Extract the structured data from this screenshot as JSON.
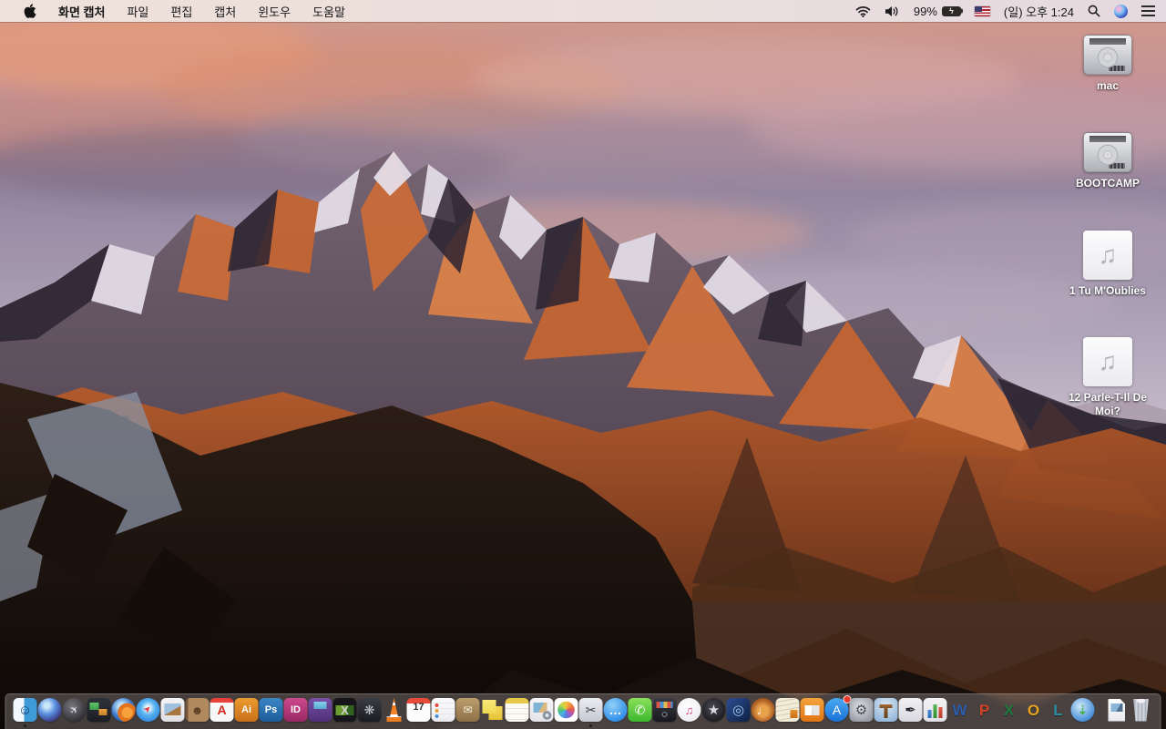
{
  "menu_bar": {
    "apple_icon": "apple-logo",
    "menus": [
      {
        "key": "app",
        "label": "화면 캡처",
        "active": true
      },
      {
        "key": "file",
        "label": "파일",
        "active": false
      },
      {
        "key": "edit",
        "label": "편집",
        "active": false
      },
      {
        "key": "capture",
        "label": "캡처",
        "active": false
      },
      {
        "key": "window",
        "label": "윈도우",
        "active": false
      },
      {
        "key": "help",
        "label": "도움말",
        "active": false
      }
    ],
    "status": {
      "battery_percent": "99%",
      "battery_charging": true,
      "clock": "(일) 오후 1:24",
      "icons": [
        "wifi-icon",
        "volume-icon",
        "battery-icon",
        "us-flag-icon",
        "spotlight-icon",
        "siri-icon",
        "notification-center-icon"
      ]
    }
  },
  "desktop": {
    "wallpaper": {
      "theme": "sierra-mountain-sunset",
      "sky_top": "#d49a87",
      "sky_mid": "#95869f",
      "sunlit_rock": "#cf6d36",
      "snow": "#e6e0ea",
      "foreground_rock": "#1a110c"
    },
    "icons": [
      {
        "name": "mac",
        "label": "mac",
        "type": "hard-drive"
      },
      {
        "name": "bootcamp",
        "label": "BOOTCAMP",
        "type": "hard-drive"
      },
      {
        "name": "tu-moublies",
        "label": "1 Tu M'Oublies",
        "type": "audio-file",
        "glyph": "♫"
      },
      {
        "name": "parle-t-il-de-moi",
        "label": "12 Parle-T-Il De Moi?",
        "type": "audio-file",
        "glyph": "♫"
      }
    ]
  },
  "dock": {
    "items": [
      {
        "name": "finder",
        "glyph": "☺",
        "fg": "#17406e",
        "fs": 15,
        "bg": "linear-gradient(90deg,#f0f8fd 0 46%,#3f9ad8 46%)",
        "shape": "square",
        "running": true
      },
      {
        "name": "siri",
        "glyph": "",
        "bg": "radial-gradient(circle at 38% 32%,#c8e8f8 0 12%,#5a8fe0 40%,#33246a 85%)",
        "shape": "circle"
      },
      {
        "name": "launchpad",
        "glyph": "✈",
        "fg": "#d8d8de",
        "fs": 12,
        "rot": -45,
        "bg": "radial-gradient(circle at 40% 35%,#77777d,#2e2e33 75%)",
        "shape": "circle"
      },
      {
        "name": "mission-control",
        "glyph": "",
        "bg": "linear-gradient(#5fc46a,#3f9f4a) 3px 5px/10px 8px no-repeat,linear-gradient(#e8a23c,#c8822a) 13px 12px/9px 7px no-repeat,linear-gradient(#2e3138,#1c1e24)",
        "shape": "square"
      },
      {
        "name": "firefox",
        "glyph": "",
        "bg": "radial-gradient(circle at 66% 62%,#f6a13b 0 26%,#e5741f 26% 44%,rgba(0,0,0,0) 45%),radial-gradient(circle at 42% 36%,#bfe0f6 0 16%,#3e7bd0 50%,#1c3f77)",
        "shape": "circle"
      },
      {
        "name": "safari",
        "glyph": "➤",
        "fg": "#e23b3b",
        "fs": 10,
        "rot": -45,
        "bg": "radial-gradient(circle at 50% 42%,#eef8ff 0 10%,#55b2f0 40%,#1f6fd0)",
        "shape": "circle"
      },
      {
        "name": "preview",
        "glyph": "",
        "bg": "linear-gradient(150deg,#9fc0dc 0 55%,#a8763f 55%) 4px 6px/18px 13px no-repeat,linear-gradient(#f4f4f6,#dfdfe4)",
        "shape": "square"
      },
      {
        "name": "contacts",
        "glyph": "☻",
        "fg": "#5a3f26",
        "fs": 13,
        "bg": "linear-gradient(90deg,#77573a 0 12%,#b08a5e 12%)",
        "shape": "square"
      },
      {
        "name": "acrobat",
        "glyph": "A",
        "fg": "#d2281e",
        "fs": 14,
        "bold": true,
        "bg": "linear-gradient(#e8413a 0 5px,#f7f7f7 5px)",
        "shape": "square"
      },
      {
        "name": "illustrator",
        "glyph": "Ai",
        "fg": "#ffffff",
        "fs": 11,
        "bold": true,
        "bg": "linear-gradient(#eb9a2f,#c9701a)",
        "shape": "square"
      },
      {
        "name": "photoshop",
        "glyph": "Ps",
        "fg": "#ffffff",
        "fs": 11,
        "bold": true,
        "bg": "linear-gradient(#3a85c4,#1d5c9a)",
        "shape": "square"
      },
      {
        "name": "indesign",
        "glyph": "ID",
        "fg": "#ffffff",
        "fs": 11,
        "bold": true,
        "bg": "linear-gradient(#cc4a8e,#992864)",
        "shape": "square"
      },
      {
        "name": "toast",
        "glyph": "",
        "bg": "linear-gradient(#86d2ec,#58a8d2) 6px 4px/14px 8px no-repeat,linear-gradient(#7a4fa8,#4e2f78)",
        "shape": "square"
      },
      {
        "name": "app-x",
        "glyph": "X",
        "fg": "#d0d0d6",
        "fs": 13,
        "bold": true,
        "bg": "linear-gradient(105deg,#6a9c2f 0 60%,#31641f 60%) 3px 8px/20px 11px no-repeat,#16161a",
        "shape": "square"
      },
      {
        "name": "fan-utility",
        "glyph": "❋",
        "fg": "#c2c2cc",
        "fs": 14,
        "bg": "linear-gradient(#3c3c44,#1b1b22)",
        "shape": "square"
      },
      {
        "name": "vlc",
        "glyph": "",
        "bg": "repeating-linear-gradient(180deg,#f08528 0 5px,#ffffff 5px 8px,#ef7c1e 8px 13px)",
        "shape": "cone"
      },
      {
        "name": "calendar",
        "glyph": "17",
        "fg": "#333333",
        "fs": 11,
        "bold": true,
        "pad_top": 5,
        "bg": "linear-gradient(#e84b3a 0 6px,#fcfcfc 6px)",
        "shape": "square"
      },
      {
        "name": "reminders",
        "glyph": "",
        "bg": "radial-gradient(circle 2px at 6px 8px,#e5493a 97%,rgba(0,0,0,0)),radial-gradient(circle 2px at 6px 14px,#e8a13c 97%,rgba(0,0,0,0)),radial-gradient(circle 2px at 6px 20px,#4a90d9 97%,rgba(0,0,0,0)),repeating-linear-gradient(rgba(0,0,0,0) 0 5px,#e4e4ea 5px 6px),linear-gradient(#fbfbfd,#eeeef2)",
        "shape": "square"
      },
      {
        "name": "archive-utility",
        "glyph": "✉",
        "fg": "#f4eedd",
        "fs": 12,
        "bg": "linear-gradient(#bb9d6d,#8e7048)",
        "shape": "square"
      },
      {
        "name": "stickies",
        "glyph": "",
        "bg": "linear-gradient(#f8e87a,#f0d84f) 2px 2px/15px 15px no-repeat,linear-gradient(#f2d855,#e4c23a) 9px 9px/15px 15px no-repeat",
        "shape": "plain"
      },
      {
        "name": "notes",
        "glyph": "",
        "bg": "linear-gradient(#e8c84a 0 6px,rgba(0,0,0,0) 6px),repeating-linear-gradient(#fcfcf5 0 5px,#e2e2d8 5px 6px)",
        "shape": "square"
      },
      {
        "name": "image-capture",
        "glyph": "",
        "bg": "radial-gradient(circle 5px at 19px 19px,#e2e6ec 0 2px,#8a93a2 2px 4.5px,rgba(0,0,0,0) 5px),linear-gradient(120deg,#7fb3d8 0 55%,#d8b87f 55%) 4px 5px/15px 11px no-repeat,linear-gradient(#f6f6f8,#e4e4ea)",
        "shape": "square"
      },
      {
        "name": "photos",
        "glyph": "",
        "bg": "radial-gradient(circle at 50% 50%,rgba(0,0,0,0) 0 9px,#ffffff 9.5px),conic-gradient(#f3c13f,#ee8b3b,#e05656,#a85cc9,#5b79dd,#45b4e5,#52c06f,#c2d84d,#f3c13f)",
        "shape": "square"
      },
      {
        "name": "grab-screen-capture",
        "glyph": "✂",
        "fg": "#3a3a42",
        "fs": 14,
        "bg": "linear-gradient(#ecedf1,#c6c8d2)",
        "shape": "square",
        "running": true
      },
      {
        "name": "messages",
        "glyph": "…",
        "fg": "#ffffff",
        "fs": 14,
        "bold": true,
        "bg": "radial-gradient(circle at 38% 30%,#8fd0f8,#2e8de8 75%)",
        "shape": "circle"
      },
      {
        "name": "facetime",
        "glyph": "✆",
        "fg": "#ffffff",
        "fs": 14,
        "bg": "linear-gradient(#8ae05a,#3cb82e)",
        "shape": "square"
      },
      {
        "name": "photo-booth",
        "glyph": "",
        "bg": "repeating-linear-gradient(90deg,#d65547 0 4px,#4a90d9 4px 8px,#e2bc48 8px 12px) 4px 4px/18px 7px no-repeat,radial-gradient(circle 4px at 13px 18px,#15151a 0 1.5px,#6a6a74 1.5px 3px,#2a2a32 3px 4px,rgba(0,0,0,0) 4.5px),linear-gradient(#3c3c46,#17171d)",
        "shape": "square"
      },
      {
        "name": "itunes",
        "glyph": "♫",
        "fg": "#d6487e",
        "fs": 13,
        "bg": "radial-gradient(circle at 42% 36%,#ffffff,#ececf2 80%)",
        "shape": "circle"
      },
      {
        "name": "imovie",
        "glyph": "★",
        "fg": "#d8d8de",
        "fs": 15,
        "bg": "radial-gradient(circle at 45% 40%,#4a4a52,#17171c 80%)",
        "shape": "circle"
      },
      {
        "name": "idvd",
        "glyph": "◎",
        "fg": "#9ec8f2",
        "fs": 15,
        "bg": "linear-gradient(135deg,#2c4f92,#101f42)",
        "shape": "square"
      },
      {
        "name": "garageband",
        "glyph": "♩",
        "fg": "#ffffff",
        "fs": 13,
        "bg": "radial-gradient(circle at 50% 55%,#e8a24c 0 30%,#b26428 60%,#6e3a14)",
        "shape": "circle"
      },
      {
        "name": "documents-app",
        "glyph": "",
        "bg": "linear-gradient(#e8912d,#c96f16) 16px 13px/8px 9px no-repeat,repeating-linear-gradient(170deg,#f2ecd9 0 4px,#d4cbb2 4px 5px)",
        "shape": "square"
      },
      {
        "name": "ibooks",
        "glyph": "",
        "bg": "linear-gradient(#d0d0d0,#d0d0d0) 12.5px 8px/1px 11px no-repeat,linear-gradient(100deg,#ffffff 0 48%,#e6e6e6 52%) 5px 8px/16px 11px no-repeat,linear-gradient(#f4a43c,#e07414)",
        "shape": "square"
      },
      {
        "name": "app-store",
        "glyph": "A",
        "fg": "#ffffff",
        "fs": 14,
        "bg": "linear-gradient(#4aa8f0,#1a72d8)",
        "shape": "circle",
        "badge": true
      },
      {
        "name": "system-preferences",
        "glyph": "⚙",
        "fg": "#4a4a52",
        "fs": 15,
        "bg": "radial-gradient(circle at 45% 40%,#e2e2e8,#9598a2 80%)",
        "shape": "square"
      },
      {
        "name": "keynote",
        "glyph": "",
        "bg": "linear-gradient(#8a5a2a,#66401a) 11px 10px/4px 12px no-repeat,linear-gradient(#a8713a,#7c4c22) 6px 7px/14px 4px no-repeat,radial-gradient(circle at 50% 30%,#d8e6f2,#86aed6)",
        "shape": "square"
      },
      {
        "name": "pages",
        "glyph": "✒",
        "fg": "#26262e",
        "fs": 15,
        "bg": "linear-gradient(#f2f2f5,#d8d8de)",
        "shape": "square"
      },
      {
        "name": "numbers",
        "glyph": "",
        "bg": "linear-gradient(#4a90d9,#2a6ab0) 5px 13px/4px 9px no-repeat,linear-gradient(#58b858,#2f8f2f) 11px 7px/4px 15px no-repeat,linear-gradient(#e05a4a,#b83a2a) 17px 10px/4px 12px no-repeat,linear-gradient(#f4f4f6,#e0e0e6)",
        "shape": "square"
      },
      {
        "name": "word",
        "glyph": "W",
        "fg": "#2b5cad",
        "fs": 17,
        "bold": true,
        "bg": "rgba(0,0,0,0)",
        "shape": "plain"
      },
      {
        "name": "powerpoint",
        "glyph": "P",
        "fg": "#d14224",
        "fs": 17,
        "bold": true,
        "bg": "rgba(0,0,0,0)",
        "shape": "plain"
      },
      {
        "name": "excel",
        "glyph": "X",
        "fg": "#1e7a3c",
        "fs": 17,
        "bold": true,
        "bg": "rgba(0,0,0,0)",
        "shape": "plain"
      },
      {
        "name": "outlook",
        "glyph": "O",
        "fg": "#e8a41e",
        "fs": 17,
        "bold": true,
        "bg": "rgba(0,0,0,0)",
        "shape": "plain"
      },
      {
        "name": "lync",
        "glyph": "L",
        "fg": "#2a8fa0",
        "fs": 17,
        "bold": true,
        "bg": "rgba(0,0,0,0)",
        "shape": "plain"
      },
      {
        "name": "download-manager",
        "glyph": "⇣",
        "fg": "#3fae3f",
        "fs": 14,
        "bold": true,
        "bg": "radial-gradient(circle at 40% 35%,#cfe8fa,#4a90d9 70%,#27557e)",
        "shape": "circle"
      },
      {
        "name": "separator",
        "separator": true
      },
      {
        "name": "document-file",
        "glyph": "",
        "bg": "linear-gradient(120deg,#8ab4d8 0 60%,#50708e 60%) 3px 5px/13px 9px no-repeat,linear-gradient(#ffffff,#e8e8ee)",
        "shape": "page"
      },
      {
        "name": "trash",
        "glyph": "",
        "bg": "radial-gradient(ellipse 8px 4px at 50% 2px,#f2f2f6 60%,rgba(0,0,0,0) 61%),repeating-linear-gradient(90deg,#d2d6de 0 2px,#aeb4c0 2px 4px)",
        "shape": "trash"
      }
    ]
  }
}
